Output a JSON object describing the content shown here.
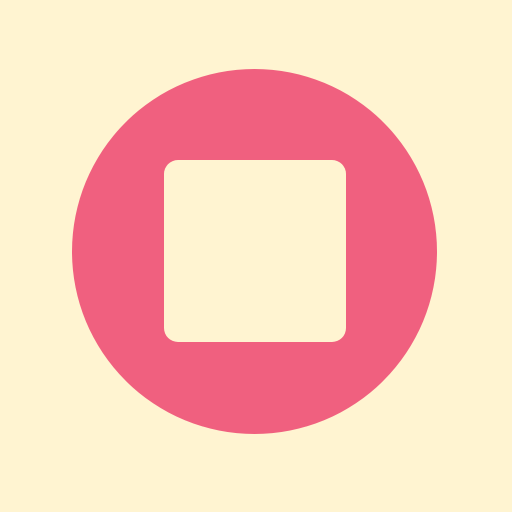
{
  "app": {
    "background_color": "#FFF4D1"
  },
  "control": {
    "type": "stop",
    "icon": "stop-icon",
    "button_color": "#F0607F",
    "icon_color": "#FFF4D1"
  }
}
